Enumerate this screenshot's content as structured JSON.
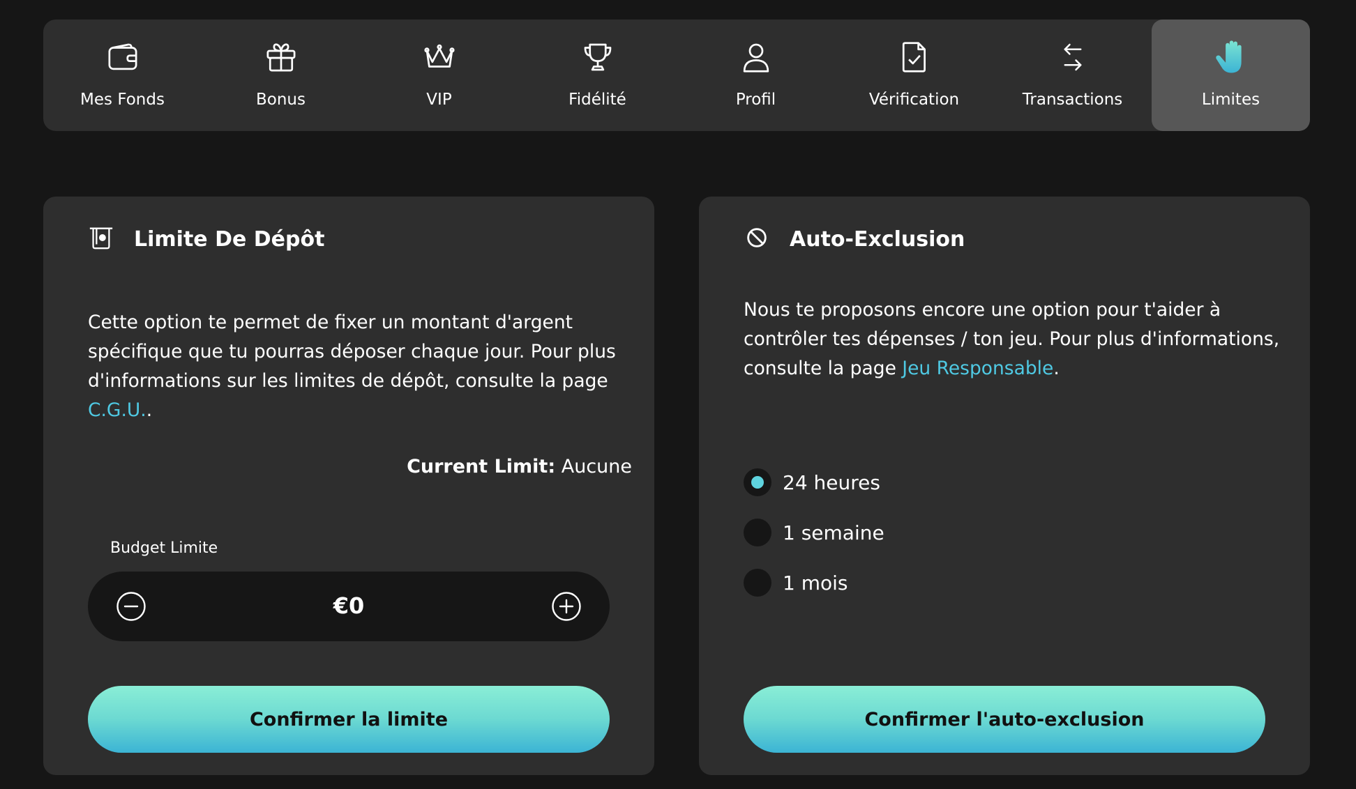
{
  "nav": {
    "items": [
      {
        "label": "Mes Fonds",
        "icon": "wallet-icon"
      },
      {
        "label": "Bonus",
        "icon": "gift-icon"
      },
      {
        "label": "VIP",
        "icon": "crown-icon"
      },
      {
        "label": "Fidélité",
        "icon": "trophy-icon"
      },
      {
        "label": "Profil",
        "icon": "user-icon"
      },
      {
        "label": "Vérification",
        "icon": "document-check-icon"
      },
      {
        "label": "Transactions",
        "icon": "arrows-exchange-icon"
      },
      {
        "label": "Limites",
        "icon": "hand-icon",
        "active": true
      }
    ]
  },
  "deposit": {
    "title": "Limite De Dépôt",
    "icon": "deposit-icon",
    "description": "Cette option te permet de fixer un montant d'argent spécifique que tu pourras déposer chaque jour. Pour plus d'informations sur les limites de dépôt, consulte la page ",
    "link_text": "C.G.U.",
    "link_suffix": ".",
    "current_limit_label": "Current Limit:",
    "current_limit_value": "Aucune",
    "budget_label": "Budget Limite",
    "budget_value": "€0",
    "confirm_label": "Confirmer la limite"
  },
  "exclusion": {
    "title": "Auto-Exclusion",
    "icon": "block-icon",
    "description": "Nous te proposons encore une option pour t'aider à contrôler tes dépenses / ton jeu. Pour plus d'informations, consulte la page ",
    "link_text": "Jeu Responsable",
    "link_suffix": ".",
    "options": [
      {
        "label": "24 heures",
        "selected": true
      },
      {
        "label": "1 semaine",
        "selected": false
      },
      {
        "label": "1 mois",
        "selected": false
      }
    ],
    "confirm_label": "Confirmer l'auto-exclusion"
  },
  "colors": {
    "background": "#161616",
    "card": "#2e2e2e",
    "active_tab": "#575757",
    "accent": "#4fc9e3",
    "button_gradient_top": "#8aeed6",
    "button_gradient_bottom": "#3cb4d4"
  }
}
